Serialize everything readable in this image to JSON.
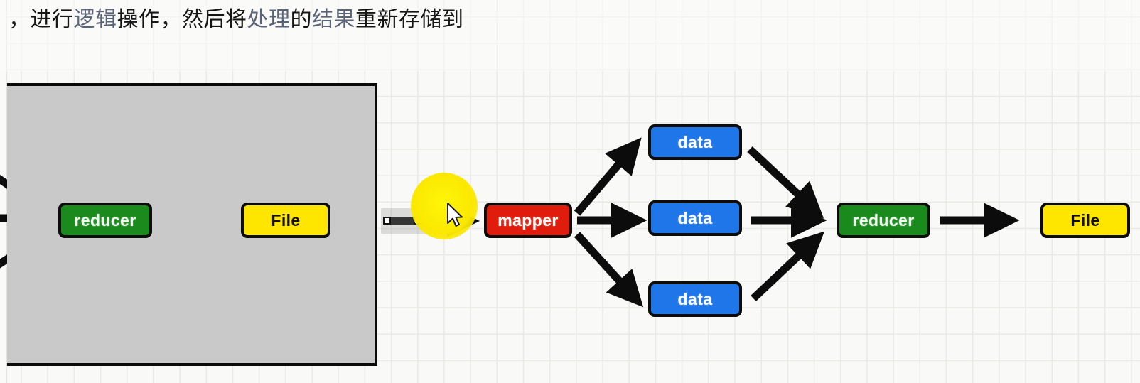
{
  "caption": {
    "prefix": "，",
    "segments": [
      {
        "text": "进行",
        "muted": false
      },
      {
        "text": "逻辑",
        "muted": true
      },
      {
        "text": "操作，然后将",
        "muted": false
      },
      {
        "text": "处理",
        "muted": true
      },
      {
        "text": "的",
        "muted": false
      },
      {
        "text": "结果",
        "muted": true
      },
      {
        "text": "重新存储到",
        "muted": false
      }
    ],
    "full_text": "，进行逻辑操作，然后将处理的结果重新存储到"
  },
  "diagram": {
    "title": "mapreduce-dataflow",
    "nodes": {
      "left_reducer": {
        "label": "reducer",
        "color": "#1a8a1c",
        "kind": "reducer"
      },
      "left_file": {
        "label": "File",
        "color": "#ffe600",
        "kind": "file"
      },
      "mapper": {
        "label": "mapper",
        "color": "#e01c0d",
        "kind": "mapper"
      },
      "data_top": {
        "label": "data",
        "color": "#1f76e8",
        "kind": "data"
      },
      "data_middle": {
        "label": "data",
        "color": "#1f76e8",
        "kind": "data"
      },
      "data_bottom": {
        "label": "data",
        "color": "#1f76e8",
        "kind": "data"
      },
      "right_reducer": {
        "label": "reducer",
        "color": "#1a8a1c",
        "kind": "reducer"
      },
      "right_file": {
        "label": "File",
        "color": "#ffe600",
        "kind": "file"
      }
    },
    "panel": {
      "label": "gray-occluding-panel",
      "fill": "#c9c9c9",
      "border": "#0a0a0a"
    }
  },
  "overlay": {
    "selected_edge": {
      "name": "mapper-input-arrow",
      "handles": 2
    },
    "click_highlight_color": "#fbe800",
    "cursor": "arrow-pointer"
  },
  "colors": {
    "green": "#1a8a1c",
    "yellow": "#ffe600",
    "red": "#e01c0d",
    "blue": "#1f76e8",
    "black": "#0c0c0c",
    "panel_gray": "#c9c9c9",
    "grid_line": "#e9e9e6",
    "page_bg": "#f9f9f7"
  }
}
